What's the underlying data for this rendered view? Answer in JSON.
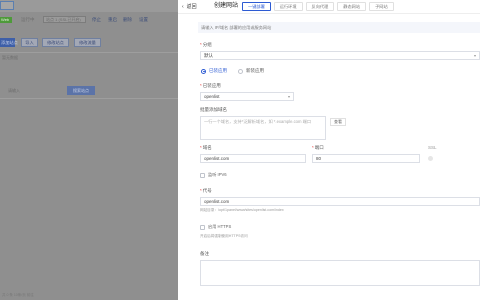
{
  "background": {
    "top_tab": "",
    "status_badge": "Web",
    "row_text_1": "运行中",
    "inbox_text": "站点 1 (SSL已开启)",
    "row_links": [
      "停止",
      "重启",
      "删除",
      "设置"
    ],
    "buttons": [
      "添加站点",
      "导入",
      "修改站点",
      "修改流量"
    ],
    "empty_text": "暂无数据",
    "search_placeholder": "请输入",
    "search_button": "搜索站点",
    "footer_text": "共 0 条  10条/页  前往"
  },
  "drawer": {
    "back_label": "返回",
    "title": "创建网站",
    "tabs": [
      {
        "label": "一键部署",
        "active": true
      },
      {
        "label": "运行环境",
        "active": false
      },
      {
        "label": "反向代理",
        "active": false
      },
      {
        "label": "静态网站",
        "active": false
      },
      {
        "label": "子网站",
        "active": false
      }
    ],
    "notice": "请输入 IP/域名 部署的应用或服务网站",
    "group_label": "分组",
    "group_value": "默认",
    "mode_options": [
      {
        "label": "已装应用",
        "selected": true
      },
      {
        "label": "新装应用",
        "selected": false
      }
    ],
    "app_label": "已装应用",
    "app_value": "openlist",
    "domain_label": "批量添加域名",
    "domain_placeholder": "一行一个域名，支持*泛解析域名，如 *.example.com 端口",
    "domain_example": "查看",
    "primary_domain_label": "域名",
    "primary_domain_value": "openlist.com",
    "port_label": "端口",
    "port_value": "80",
    "ssl_label": "SSL",
    "ipv6_label": "监听 IPV6",
    "alias_label": "代号",
    "alias_value": "openlist.com",
    "alias_hint": "网站目录：/opt/1panel/www/sites/openlist.com/index",
    "https_label": "启用 HTTPS",
    "https_hint": "开启后将强制使用HTTPS访问",
    "remark_label": "备注"
  }
}
